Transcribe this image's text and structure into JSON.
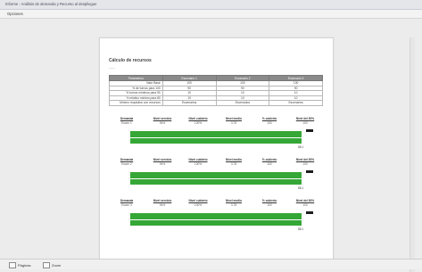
{
  "window": {
    "title": "Informe - Análisis de demanda y Recurso al despliegue"
  },
  "menu": {
    "label": "Opciones"
  },
  "report": {
    "title": "Cálculo de recursos",
    "subtitle": "——",
    "table": {
      "headers": [
        "Parámetros",
        "Escenario 1",
        "Escenario 2",
        "Escenario 3"
      ],
      "rows": [
        [
          "Valor Base",
          "100",
          "100",
          "100"
        ],
        [
          "% de turnos para 100",
          "90",
          "90",
          "90"
        ],
        [
          "% turnos mínimos para 90",
          "10",
          "10",
          "10"
        ],
        [
          "% relativo mínimo para 80",
          "10",
          "10",
          "10"
        ],
        [
          "Mínimo requisitos con recursos",
          "Escenarios",
          "Escenarios",
          "Escenarios"
        ]
      ]
    },
    "blocks": [
      {
        "headers": [
          "Demanda",
          "Nivel servicio",
          "Nivel cubierto",
          "Nivel medio",
          "% cubierto",
          "Nivel del 80%"
        ],
        "values": [
          "Escen 1",
          "94%",
          "100%",
          "3.78",
          "100",
          "100"
        ],
        "bar_value": 0.96,
        "bar2_value": 0.96,
        "scale_label": "88.1"
      },
      {
        "headers": [
          "Demanda",
          "Nivel servicio",
          "Nivel cubierto",
          "Nivel medio",
          "% cubierto",
          "Nivel del 80%"
        ],
        "values": [
          "Escen 2",
          "94%",
          "100%",
          "3.78",
          "100",
          "100"
        ],
        "bar_value": 0.96,
        "bar2_value": 0.96,
        "scale_label": "88.1"
      },
      {
        "headers": [
          "Demanda",
          "Nivel servicio",
          "Nivel cubierto",
          "Nivel medio",
          "% cubierto",
          "Nivel del 80%"
        ],
        "values": [
          "Escen 3",
          "94%",
          "100%",
          "3.78",
          "100",
          "100"
        ],
        "bar_value": 0.96,
        "bar2_value": 0.96,
        "scale_label": "88.1"
      }
    ]
  },
  "statusbar": {
    "pages_label": "Páginas",
    "zoom_label": "Zoom"
  },
  "colors": {
    "bar": "#35a736",
    "table_header": "#8a8a8a"
  }
}
